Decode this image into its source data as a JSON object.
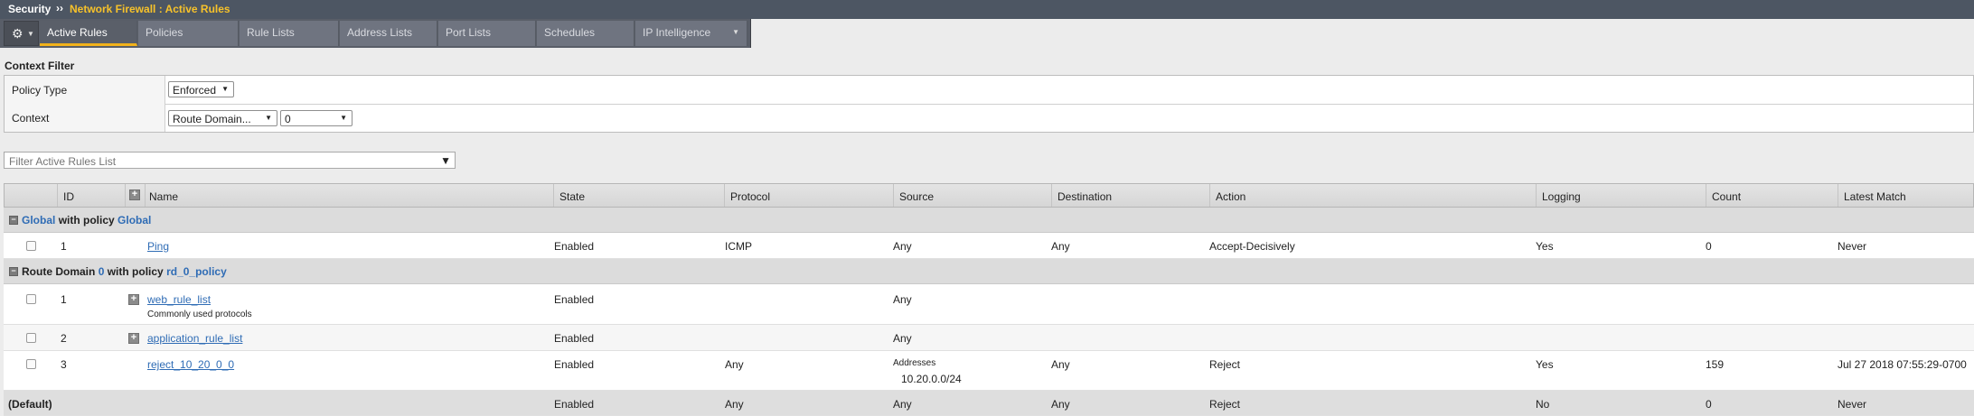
{
  "titlebar": {
    "section": "Security",
    "separator": "››",
    "page": "Network Firewall : Active Rules"
  },
  "tabs": [
    {
      "label": "Active Rules"
    },
    {
      "label": "Policies"
    },
    {
      "label": "Rule Lists"
    },
    {
      "label": "Address Lists"
    },
    {
      "label": "Port Lists"
    },
    {
      "label": "Schedules"
    },
    {
      "label": "IP Intelligence"
    }
  ],
  "icons": {
    "gear": "gear-icon",
    "filter": "funnel-icon",
    "expand": "plus-box-icon",
    "collapse": "minus-box-icon"
  },
  "context_filter": {
    "title": "Context Filter",
    "policy_type_label": "Policy Type",
    "policy_type_value": "Enforced",
    "context_label": "Context",
    "context_value": "Route Domain...",
    "context_id_value": "0"
  },
  "filter": {
    "placeholder": "Filter Active Rules List"
  },
  "columns": [
    "ID",
    "Name",
    "State",
    "Protocol",
    "Source",
    "Destination",
    "Action",
    "Logging",
    "Count",
    "Latest Match"
  ],
  "groups": {
    "global": {
      "prefix": "Global",
      "mid": "with policy",
      "policy": "Global"
    },
    "route_domain": {
      "prefix": "Route Domain",
      "rd": "0",
      "mid": "with policy",
      "policy": "rd_0_policy"
    }
  },
  "rows": [
    {
      "id": "1",
      "name": "Ping",
      "state": "Enabled",
      "protocol": "ICMP",
      "source": "Any",
      "destination": "Any",
      "action": "Accept-Decisively",
      "logging": "Yes",
      "count": "0",
      "latest": "Never"
    },
    {
      "id": "1",
      "name": "web_rule_list",
      "description": "Commonly used protocols",
      "state": "Enabled",
      "source": "Any"
    },
    {
      "id": "2",
      "name": "application_rule_list",
      "state": "Enabled",
      "source": "Any"
    },
    {
      "id": "3",
      "name": "reject_10_20_0_0",
      "state": "Enabled",
      "protocol": "Any",
      "source_label": "Addresses",
      "source_value": "10.20.0.0/24",
      "destination": "Any",
      "action": "Reject",
      "logging": "Yes",
      "count": "159",
      "latest": "Jul 27 2018 07:55:29-0700"
    }
  ],
  "default_row": {
    "label": "(Default)",
    "state": "Enabled",
    "protocol": "Any",
    "source": "Any",
    "destination": "Any",
    "action": "Reject",
    "logging": "No",
    "count": "0",
    "latest": "Never"
  },
  "colors": {
    "titlebar": "#4d5663",
    "accent": "#f7c22a",
    "tabbar": "#595e68",
    "link": "#2f6cb5"
  }
}
